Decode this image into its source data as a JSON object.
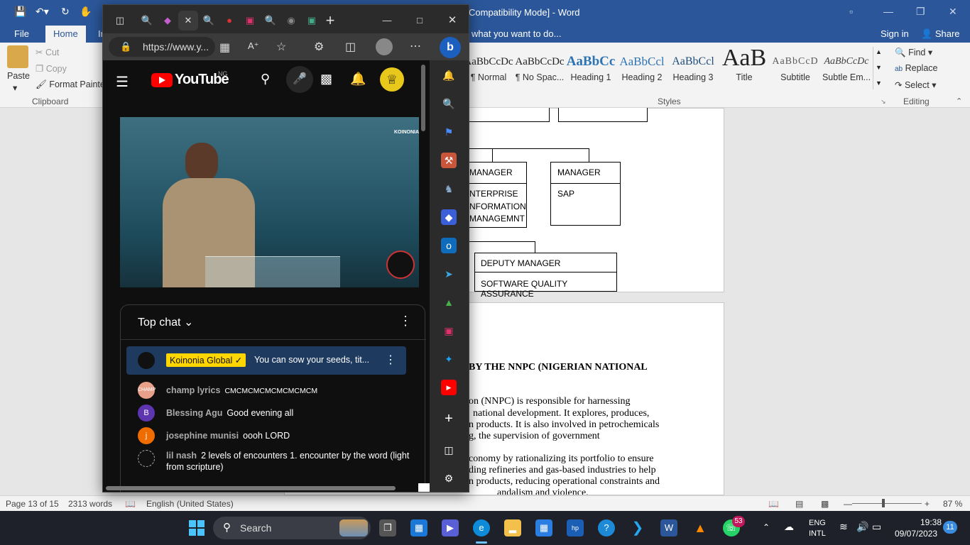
{
  "word": {
    "title": "Compatibility Mode] - Word",
    "tabs": {
      "file": "File",
      "home": "Home",
      "insert_partial": "In"
    },
    "tell_me": "what you want to do...",
    "sign_in": "Sign in",
    "share": "Share",
    "clipboard": {
      "paste": "Paste",
      "cut": "Cut",
      "copy": "Copy",
      "format_painter": "Format Painter",
      "group_label": "Clipboard"
    },
    "styles": {
      "group_label": "Styles",
      "items": [
        {
          "sample": "AaBbCcDc",
          "name": "¶ Normal"
        },
        {
          "sample": "AaBbCcDc",
          "name": "¶ No Spac..."
        },
        {
          "sample": "AaBbCc",
          "name": "Heading 1"
        },
        {
          "sample": "AaBbCcl",
          "name": "Heading 2"
        },
        {
          "sample": "AaBbCcl",
          "name": "Heading 3"
        },
        {
          "sample": "AaB",
          "name": "Title"
        },
        {
          "sample": "AaBbCcD",
          "name": "Subtitle"
        },
        {
          "sample": "AaBbCcDc",
          "name": "Subtle Em..."
        }
      ]
    },
    "editing": {
      "find": "Find",
      "replace": "Replace",
      "select": "Select",
      "group_label": "Editing"
    },
    "document": {
      "boxes": {
        "manager1_title": "MANAGER",
        "manager1_dept": "ENTERPRISE INFORMATION MANAGEMNT",
        "manager1_lines": [
          "NTERPRISE",
          "NFORMATION",
          "MANAGEMNT"
        ],
        "manager2_title": "MANAGER",
        "manager2_dept": "SAP",
        "deputy_title": "DEPUTY MANAGER",
        "deputy_dept": "SOFTWARE QUALITY ASSURANCE"
      },
      "heading_partial": "BY THE NNPC (NIGERIAN NATIONAL",
      "paragraph_lines": [
        "on (NNPC) is responsible for harnessing",
        "national development. It explores, produces,",
        "n products. It is also involved in petrochemicals",
        "g, the supervision of government",
        "conomy by rationalizing its portfolio to ensure",
        "ding refineries and gas-based industries to help",
        "n products, reducing operational constraints and",
        "andalism and violence."
      ]
    },
    "status": {
      "page": "Page 13 of 15",
      "words": "2313 words",
      "language": "English (United States)",
      "zoom": "87 %"
    }
  },
  "edge": {
    "url": "https://www.y...",
    "youtube": {
      "logo_text": "YouTube",
      "country": "NG",
      "video_watermark": "KOINONIA",
      "chat": {
        "mode": "Top chat",
        "pinned": {
          "author": "Koinonia Global",
          "text": "You can sow your seeds, tit..."
        },
        "messages": [
          {
            "author": "champ lyrics",
            "text": "CMCMCMCMCMCMCMCM",
            "avatar": "CHAMP",
            "color": "#e9a08a"
          },
          {
            "author": "Blessing Agu",
            "text": "Good evening all",
            "avatar": "B",
            "color": "#5e35b1"
          },
          {
            "author": "josephine munisi",
            "text": "oooh LORD",
            "avatar": "j",
            "color": "#ef6c00"
          },
          {
            "author": "lil nash",
            "text": "2 levels of encounters 1. encounter by the word (light from scripture)",
            "avatar": "",
            "color": "#111111"
          }
        ]
      }
    }
  },
  "taskbar": {
    "search": "Search",
    "whatsapp_badge": "53",
    "lang1": "ENG",
    "lang2": "INTL",
    "time": "19:38",
    "date": "09/07/2023",
    "notifications": "11"
  }
}
